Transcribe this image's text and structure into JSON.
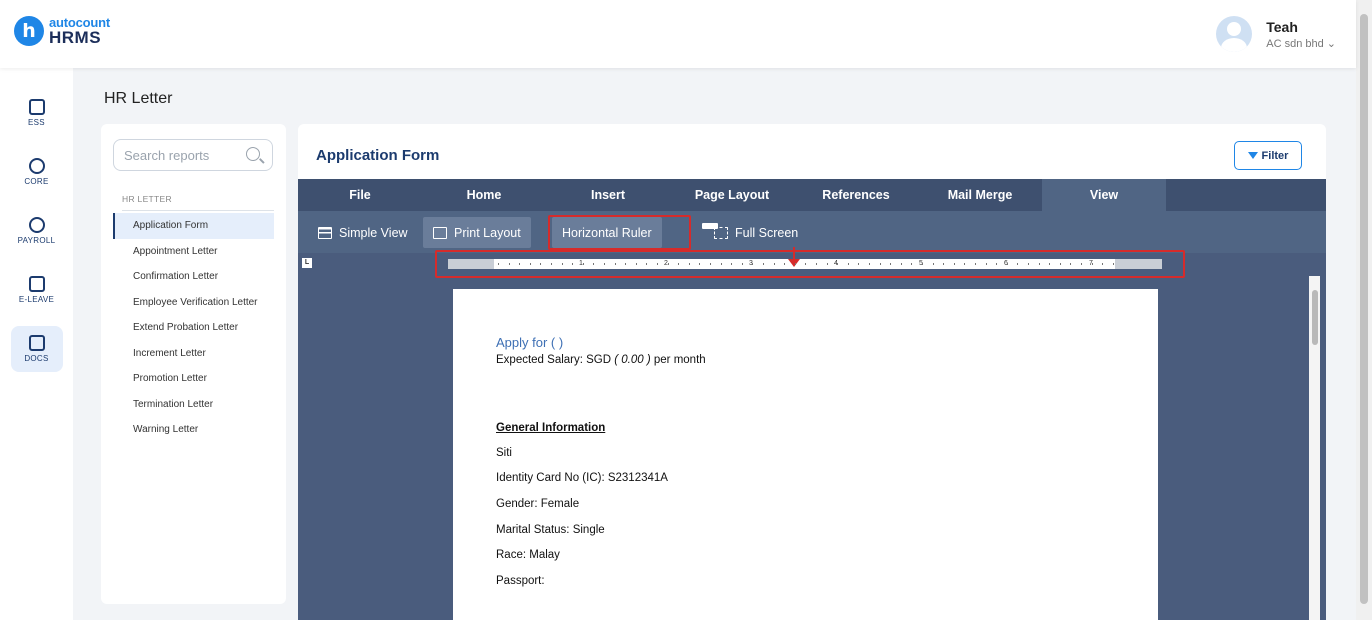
{
  "brand": {
    "top": "autocount",
    "bottom": "HRMS",
    "letter": "h"
  },
  "user": {
    "name": "Teah",
    "company": "AC sdn bhd ⌄"
  },
  "rail": [
    {
      "label": "ESS",
      "icon": "badge-icon"
    },
    {
      "label": "CORE",
      "icon": "cube-icon"
    },
    {
      "label": "PAYROLL",
      "icon": "dollar-icon"
    },
    {
      "label": "E-LEAVE",
      "icon": "calendar-icon"
    },
    {
      "label": "DOCS",
      "icon": "document-chart-icon"
    }
  ],
  "page_title": "HR Letter",
  "search": {
    "placeholder": "Search reports"
  },
  "group_label": "HR LETTER",
  "reports": [
    "Application Form",
    "Appointment Letter",
    "Confirmation Letter",
    "Employee Verification Letter",
    "Extend Probation Letter",
    "Increment Letter",
    "Promotion Letter",
    "Termination Letter",
    "Warning Letter"
  ],
  "active_report": "Application Form",
  "main": {
    "title": "Application Form",
    "filter_label": "Filter",
    "menu_tabs": [
      "File",
      "Home",
      "Insert",
      "Page Layout",
      "References",
      "Mail Merge",
      "View"
    ],
    "active_tab": "View",
    "tools": {
      "simple_view": "Simple View",
      "print_layout": "Print Layout",
      "horizontal_ruler": "Horizontal Ruler",
      "full_screen": "Full Screen"
    },
    "ruler_corner": "L",
    "ruler_numbers": [
      "1",
      "2",
      "3",
      "4",
      "5",
      "6",
      "7"
    ]
  },
  "document": {
    "apply_for": "Apply for (  )",
    "salary_prefix": "Expected Salary: SGD ",
    "salary_value": "( 0.00 )",
    "salary_suffix": " per month",
    "heading": "General Information",
    "lines": [
      "Siti",
      "Identity Card No (IC): S2312341A",
      "Gender: Female",
      "Marital Status: Single",
      "Race: Malay",
      "Passport:"
    ]
  },
  "colors": {
    "accent": "#1f86e6",
    "navy": "#1c3b6e",
    "menubar": "#3e506f",
    "toolbar": "#506584",
    "highlight": "#d62b2b"
  }
}
